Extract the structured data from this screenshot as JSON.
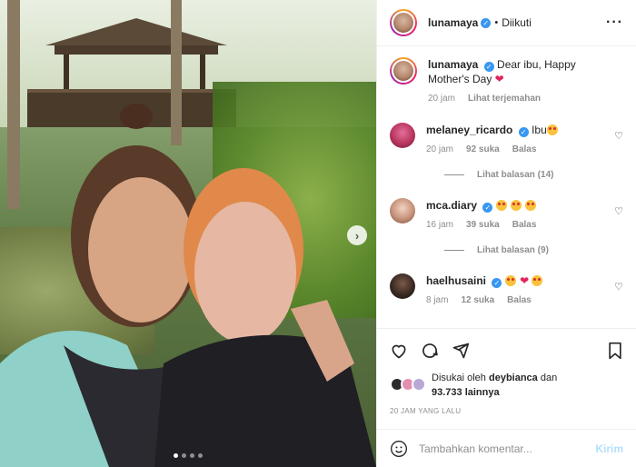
{
  "post": {
    "username": "lunamaya",
    "follow_label": "Diikuti",
    "caption_user": "lunamaya",
    "caption_text": "Dear ibu, Happy Mother's Day",
    "caption_time": "20 jam",
    "translate_label": "Lihat terjemahan"
  },
  "comments": [
    {
      "user": "melaney_ricardo",
      "text": "Ibu",
      "time": "20 jam",
      "likes": "92 suka",
      "reply_label": "Balas",
      "view_replies": "Lihat balasan (14)"
    },
    {
      "user": "mca.diary",
      "text": "",
      "time": "16 jam",
      "likes": "39 suka",
      "reply_label": "Balas",
      "view_replies": "Lihat balasan (9)"
    },
    {
      "user": "haelhusaini",
      "text": "",
      "time": "8 jam",
      "likes": "12 suka",
      "reply_label": "Balas"
    }
  ],
  "likes": {
    "prefix": "Disukai oleh",
    "user": "deybianca",
    "joiner": "dan",
    "count": "93.733 lainnya"
  },
  "timestamp": "20 JAM YANG LALU",
  "composer": {
    "placeholder": "Tambahkan komentar...",
    "send_label": "Kirim"
  },
  "carousel": {
    "slides": 4,
    "active": 1
  },
  "colors": {
    "verified": "#3897f0",
    "heart": "#e0245e",
    "send": "#b2dffc"
  }
}
